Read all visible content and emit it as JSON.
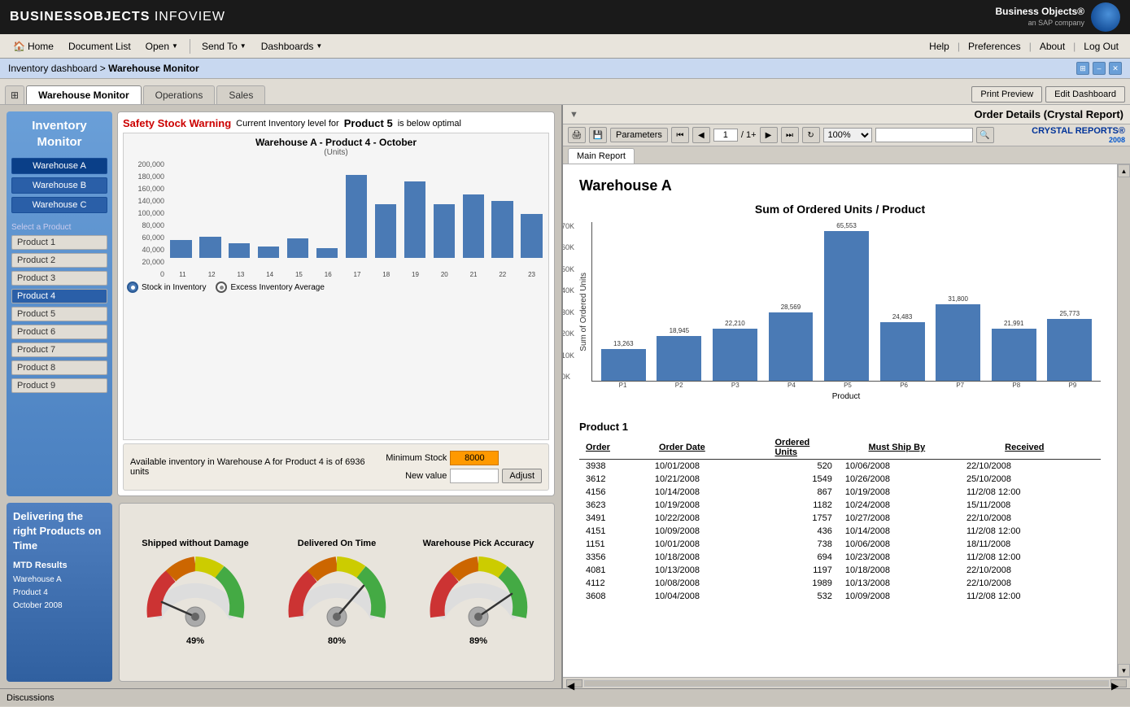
{
  "app": {
    "title_bold": "BUSINESSOBJECTS",
    "title_normal": " INFOVIEW"
  },
  "nav": {
    "home": "Home",
    "document_list": "Document List",
    "open": "Open",
    "send_to": "Send To",
    "dashboards": "Dashboards",
    "help": "Help",
    "preferences": "Preferences",
    "about": "About",
    "logout": "Log Out"
  },
  "breadcrumb": {
    "part1": "Inventory dashboard",
    "separator": " > ",
    "part2": "Warehouse Monitor"
  },
  "tabs": {
    "warehouse_monitor": "Warehouse Monitor",
    "operations": "Operations",
    "sales": "Sales",
    "print_preview": "Print Preview",
    "edit_dashboard": "Edit Dashboard"
  },
  "inventory_monitor": {
    "title": "Inventory Monitor",
    "warehouses": [
      "Warehouse A",
      "Warehouse B",
      "Warehouse C"
    ],
    "selected_warehouse": "Warehouse A",
    "products_label": "Select a Product",
    "products": [
      "Product 1",
      "Product 2",
      "Product 3",
      "Product 4",
      "Product 5",
      "Product 6",
      "Product 7",
      "Product 8",
      "Product 9"
    ],
    "selected_product": "Product 4"
  },
  "chart": {
    "title": "Warehouse A - Product 4 - October",
    "subtitle": "(Units)",
    "y_labels": [
      "200,000",
      "180,000",
      "160,000",
      "140,000",
      "100,000",
      "80,000",
      "60,000",
      "40,000",
      "20,000",
      "0"
    ],
    "bars": [
      {
        "label": "11",
        "height_pct": 18
      },
      {
        "label": "12",
        "height_pct": 22
      },
      {
        "label": "13",
        "height_pct": 15
      },
      {
        "label": "14",
        "height_pct": 12
      },
      {
        "label": "15",
        "height_pct": 20
      },
      {
        "label": "16",
        "height_pct": 10
      },
      {
        "label": "17",
        "height_pct": 85
      },
      {
        "label": "18",
        "height_pct": 55
      },
      {
        "label": "19",
        "height_pct": 78
      },
      {
        "label": "20",
        "height_pct": 55
      },
      {
        "label": "21",
        "height_pct": 65
      },
      {
        "label": "22",
        "height_pct": 58
      },
      {
        "label": "23",
        "height_pct": 45
      }
    ],
    "legend": [
      "Stock in Inventory",
      "Excess Inventory Average"
    ]
  },
  "warning": {
    "label": "Safety Stock Warning",
    "text": "Current Inventory level for",
    "product": "Product 5",
    "suffix": "is below optimal"
  },
  "inv_bottom": {
    "text": "Available inventory in Warehouse A for Product 4 is of 6936 units",
    "min_stock_label": "Minimum Stock",
    "min_stock_value": "8000",
    "new_value_label": "New value",
    "adjust_btn": "Adjust"
  },
  "delivery": {
    "title": "Delivering the right Products on Time",
    "mtd_label": "MTD Results",
    "details": [
      "Warehouse A",
      "Product 4",
      "October 2008"
    ]
  },
  "gauges": [
    {
      "title": "Shipped without Damage",
      "pct": 49,
      "color": "#cc0000"
    },
    {
      "title": "Delivered On Time",
      "pct": 80,
      "color": "#cccc00"
    },
    {
      "title": "Warehouse Pick Accuracy",
      "pct": 89,
      "color": "#cccc00"
    }
  ],
  "right_panel": {
    "title": "Order Details (Crystal Report)",
    "main_report_tab": "Main Report",
    "page": "1",
    "total_pages": "1+",
    "zoom": "100%",
    "warehouse_label": "Warehouse A",
    "chart_title": "Sum of Ordered Units / Product",
    "y_axis_label": "Sum of Ordered Units",
    "x_axis_label": "Product",
    "cr_bars": [
      {
        "label": "Product 1",
        "value": "13,263",
        "height_pct": 20
      },
      {
        "label": "Product 2",
        "value": "18,945",
        "height_pct": 28
      },
      {
        "label": "Product 3",
        "value": "22,210",
        "height_pct": 33
      },
      {
        "label": "Product 4",
        "value": "28,569",
        "height_pct": 43
      },
      {
        "label": "Product 5",
        "value": "65,553",
        "height_pct": 100
      },
      {
        "label": "Product 6",
        "value": "24,483",
        "height_pct": 37
      },
      {
        "label": "Product 7",
        "value": "31,800",
        "height_pct": 48
      },
      {
        "label": "Product 8",
        "value": "21,991",
        "height_pct": 33
      },
      {
        "label": "Product 9",
        "value": "25,773",
        "height_pct": 39
      }
    ],
    "table": {
      "product_header": "Product 1",
      "columns": [
        "Order",
        "Order Date",
        "Ordered Units",
        "Must Ship By",
        "Received"
      ],
      "rows": [
        [
          "3938",
          "10/01/2008",
          "520",
          "10/06/2008",
          "22/10/2008"
        ],
        [
          "3612",
          "10/21/2008",
          "1549",
          "10/26/2008",
          "25/10/2008"
        ],
        [
          "4156",
          "10/14/2008",
          "867",
          "10/19/2008",
          "11/2/08 12:00"
        ],
        [
          "3623",
          "10/19/2008",
          "1182",
          "10/24/2008",
          "15/11/2008"
        ],
        [
          "3491",
          "10/22/2008",
          "1757",
          "10/27/2008",
          "22/10/2008"
        ],
        [
          "4151",
          "10/09/2008",
          "436",
          "10/14/2008",
          "11/2/08 12:00"
        ],
        [
          "1151",
          "10/01/2008",
          "738",
          "10/06/2008",
          "18/11/2008"
        ],
        [
          "3356",
          "10/18/2008",
          "694",
          "10/23/2008",
          "11/2/08 12:00"
        ],
        [
          "4081",
          "10/13/2008",
          "1197",
          "10/18/2008",
          "22/10/2008"
        ],
        [
          "4112",
          "10/08/2008",
          "1989",
          "10/13/2008",
          "22/10/2008"
        ],
        [
          "3608",
          "10/04/2008",
          "532",
          "10/09/2008",
          "11/2/08 12:00"
        ]
      ]
    }
  },
  "status_bar": {
    "text": "Discussions"
  }
}
